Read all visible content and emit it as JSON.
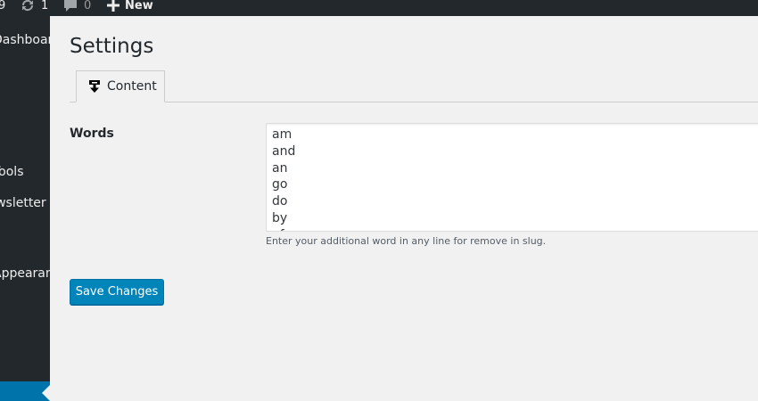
{
  "adminbar": {
    "partial_count": "9",
    "updates_count": "1",
    "comments_count": "0",
    "new_label": "New",
    "icons": {
      "updates": "refresh-icon",
      "comments": "comment-bubble-icon",
      "new": "plus-icon"
    }
  },
  "sidebar": {
    "items": [
      {
        "label": "Dashboard"
      },
      {
        "label": "Tools"
      },
      {
        "label": "Newsletter"
      },
      {
        "label": "Appearance"
      }
    ]
  },
  "page": {
    "title": "Settings",
    "tabs": [
      {
        "label": "Content",
        "icon": "pushpin-down-icon"
      }
    ]
  },
  "form": {
    "words_label": "Words",
    "words_value": "am\nand\nan\ngo\ndo\nby\nof",
    "words_help": "Enter your additional word in any line for remove in slug.",
    "save_label": "Save Changes"
  },
  "colors": {
    "adminbar_bg": "#23282d",
    "sidebar_bg": "#23282d",
    "page_bg": "#f1f1f1",
    "accent": "#0085ba",
    "current_menu": "#0073aa"
  }
}
